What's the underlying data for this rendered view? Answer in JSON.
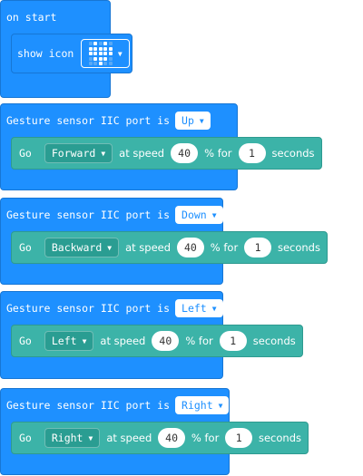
{
  "on_start": {
    "label": "on start",
    "show_icon_label": "show icon",
    "icon_name": "heart-icon"
  },
  "blocks": [
    {
      "header": "Gesture sensor IIC port is",
      "port": "Up",
      "go": "Go",
      "direction": "Forward",
      "at_speed": "at speed",
      "speed": "40",
      "percent_for": "% for",
      "duration": "1",
      "seconds": "seconds"
    },
    {
      "header": "Gesture sensor IIC port is",
      "port": "Down",
      "go": "Go",
      "direction": "Backward",
      "at_speed": "at speed",
      "speed": "40",
      "percent_for": "% for",
      "duration": "1",
      "seconds": "seconds"
    },
    {
      "header": "Gesture sensor IIC port is",
      "port": "Left",
      "go": "Go",
      "direction": "Left",
      "at_speed": "at speed",
      "speed": "40",
      "percent_for": "% for",
      "duration": "1",
      "seconds": "seconds"
    },
    {
      "header": "Gesture sensor IIC port is",
      "port": "Right",
      "go": "Go",
      "direction": "Right",
      "at_speed": "at speed",
      "speed": "40",
      "percent_for": "% for",
      "duration": "1",
      "seconds": "seconds"
    }
  ],
  "colors": {
    "event_blue": "#1E90FF",
    "command_teal": "#3CB3A8"
  }
}
